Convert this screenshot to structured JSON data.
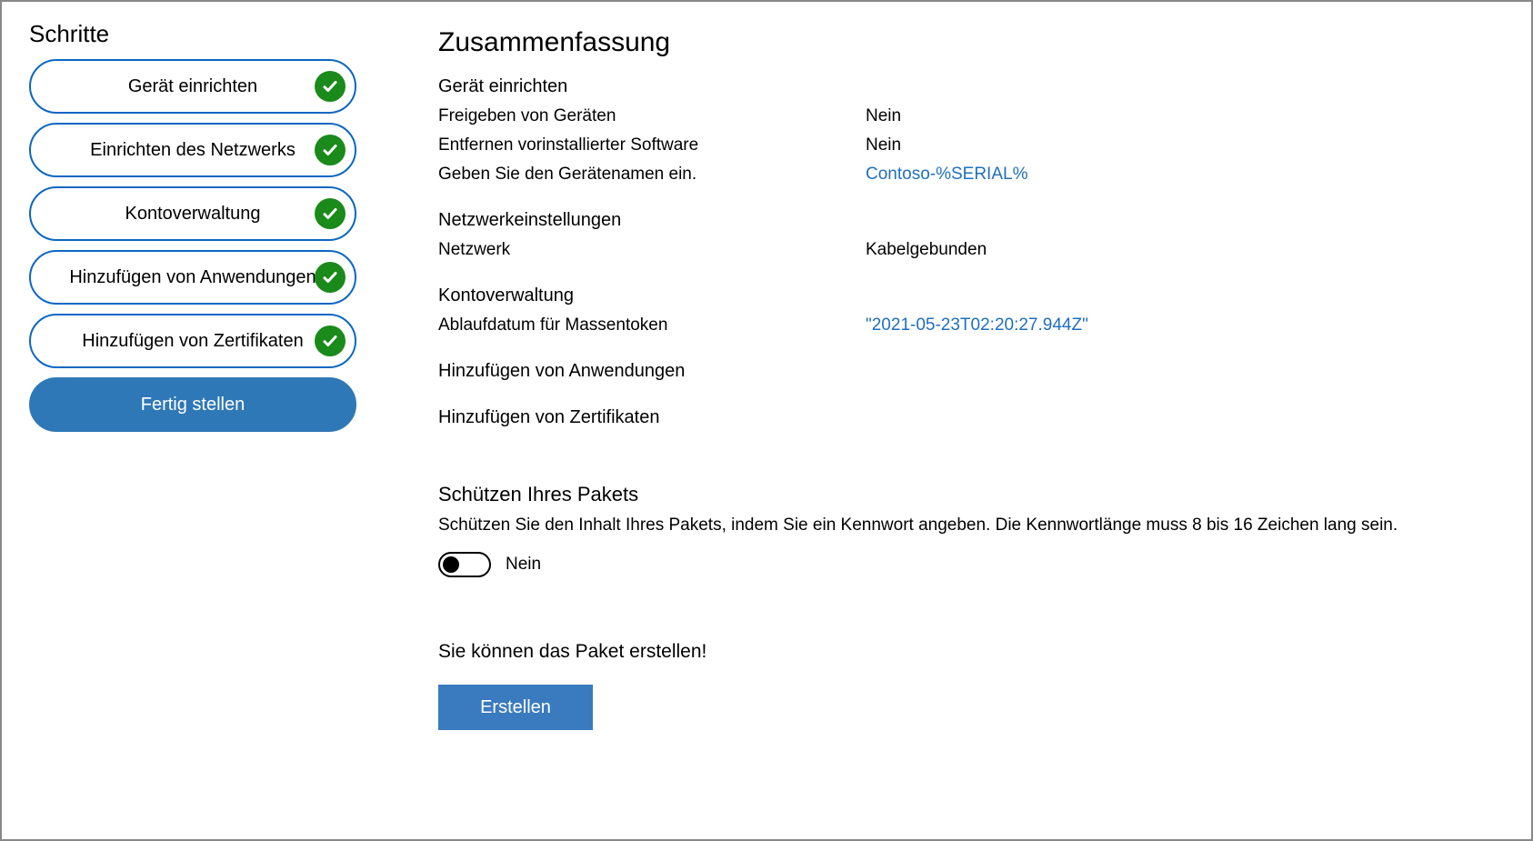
{
  "sidebar": {
    "title": "Schritte",
    "items": [
      {
        "label": "Gerät einrichten",
        "completed": true,
        "active": false
      },
      {
        "label": "Einrichten des Netzwerks",
        "completed": true,
        "active": false
      },
      {
        "label": "Kontoverwaltung",
        "completed": true,
        "active": false
      },
      {
        "label": "Hinzufügen von Anwendungen",
        "completed": true,
        "active": false
      },
      {
        "label": "Hinzufügen von Zertifikaten",
        "completed": true,
        "active": false
      },
      {
        "label": "Fertig stellen",
        "completed": false,
        "active": true
      }
    ]
  },
  "summary": {
    "title": "Zusammenfassung",
    "groups": [
      {
        "heading": "Gerät einrichten",
        "rows": [
          {
            "label": "Freigeben von Geräten",
            "value": "Nein",
            "link": false
          },
          {
            "label": "Entfernen vorinstallierter Software",
            "value": "Nein",
            "link": false
          },
          {
            "label": "Geben Sie den Gerätenamen ein.",
            "value": "Contoso-%SERIAL%",
            "link": true
          }
        ]
      },
      {
        "heading": "Netzwerkeinstellungen",
        "rows": [
          {
            "label": "Netzwerk",
            "value": "Kabelgebunden",
            "link": false
          }
        ]
      },
      {
        "heading": "Kontoverwaltung",
        "rows": [
          {
            "label": "Ablaufdatum für Massentoken",
            "value": "\"2021-05-23T02:20:27.944Z\"",
            "link": true
          }
        ]
      },
      {
        "heading": "Hinzufügen von Anwendungen",
        "rows": []
      },
      {
        "heading": "Hinzufügen von Zertifikaten",
        "rows": []
      }
    ]
  },
  "protect": {
    "title": "Schützen Ihres Pakets",
    "desc": "Schützen Sie den Inhalt Ihres Pakets, indem Sie ein Kennwort angeben. Die Kennwortlänge muss 8 bis 16 Zeichen lang sein.",
    "toggle_state": "Nein"
  },
  "create": {
    "message": "Sie können das Paket erstellen!",
    "button": "Erstellen"
  }
}
